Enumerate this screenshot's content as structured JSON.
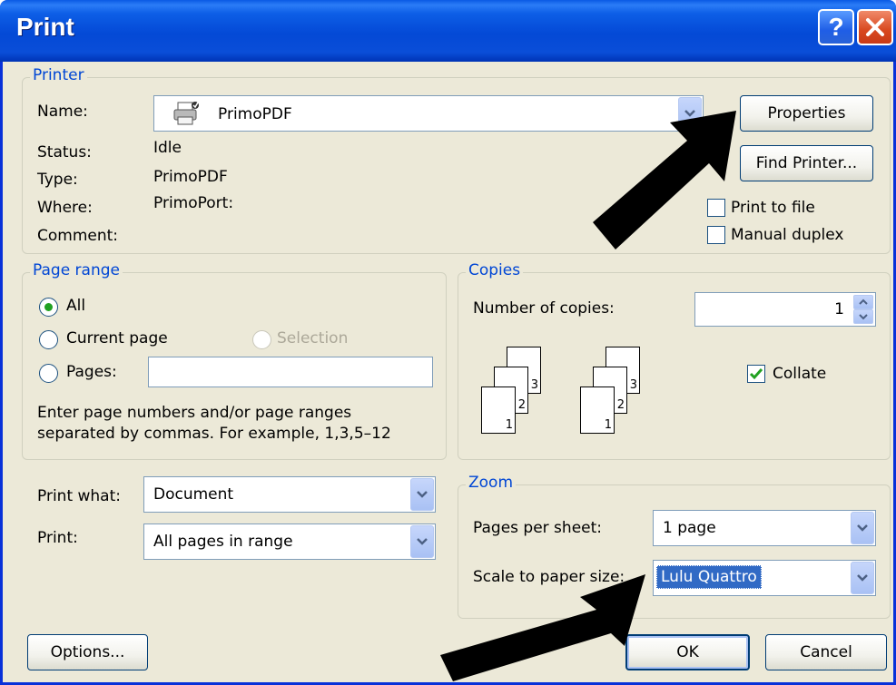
{
  "window": {
    "title": "Print"
  },
  "printer": {
    "group_label": "Printer",
    "name_label": "Name:",
    "name_value": "PrimoPDF",
    "status_label": "Status:",
    "status_value": "Idle",
    "type_label": "Type:",
    "type_value": "PrimoPDF",
    "where_label": "Where:",
    "where_value": "PrimoPort:",
    "comment_label": "Comment:",
    "properties_button": "Properties",
    "find_printer_button": "Find Printer...",
    "print_to_file_label": "Print to file",
    "print_to_file_checked": false,
    "manual_duplex_label": "Manual duplex",
    "manual_duplex_checked": false
  },
  "page_range": {
    "group_label": "Page range",
    "all_label": "All",
    "current_page_label": "Current page",
    "selection_label": "Selection",
    "pages_label": "Pages:",
    "pages_value": "",
    "selected": "All",
    "hint_line1": "Enter page numbers and/or page ranges",
    "hint_line2": "separated by commas.  For example, 1,3,5–12"
  },
  "copies": {
    "group_label": "Copies",
    "number_label": "Number of copies:",
    "number_value": "1",
    "collate_label": "Collate",
    "collate_checked": true,
    "page_numbers": [
      "3",
      "2",
      "1"
    ]
  },
  "print_options": {
    "print_what_label": "Print what:",
    "print_what_value": "Document",
    "print_label": "Print:",
    "print_value": "All pages in range"
  },
  "zoom": {
    "group_label": "Zoom",
    "pages_per_sheet_label": "Pages per sheet:",
    "pages_per_sheet_value": "1 page",
    "scale_label": "Scale to paper size:",
    "scale_value": "Lulu Quattro"
  },
  "footer": {
    "options_button": "Options...",
    "ok_button": "OK",
    "cancel_button": "Cancel"
  },
  "colors": {
    "titlebar": "#0a4ed8",
    "group_label": "#0046d5",
    "dialog_bg": "#ece9d8",
    "highlight": "#316ac5"
  },
  "icons": {
    "printer": "printer-icon",
    "help": "help-icon",
    "close": "close-icon"
  }
}
